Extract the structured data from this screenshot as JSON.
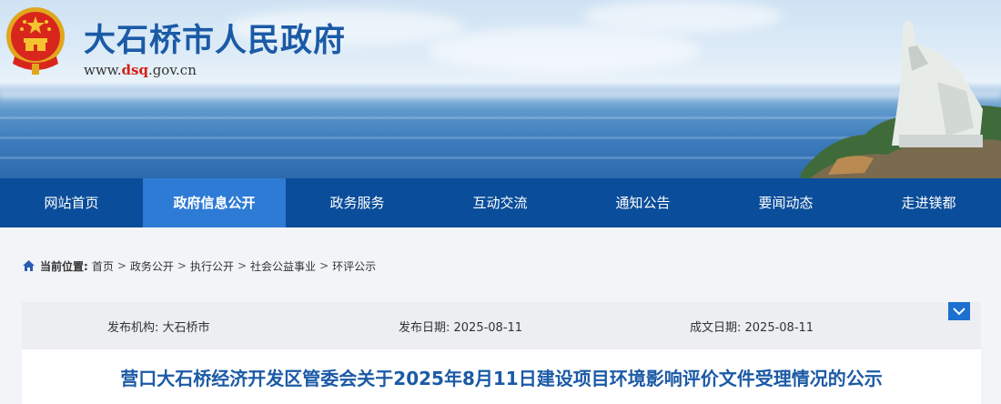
{
  "header": {
    "site_name": "大石桥市人民政府",
    "url_prefix": "www.",
    "url_highlight": "dsq",
    "url_suffix": ".gov.cn"
  },
  "nav": {
    "items": [
      {
        "label": "网站首页"
      },
      {
        "label": "政府信息公开",
        "active": true
      },
      {
        "label": "政务服务"
      },
      {
        "label": "互动交流"
      },
      {
        "label": "通知公告"
      },
      {
        "label": "要闻动态"
      },
      {
        "label": "走进镁都"
      }
    ],
    "color": "#0a4d9a",
    "active_color": "#2e7bd6"
  },
  "breadcrumb": {
    "label": "当前位置:",
    "items": [
      "首页",
      "政务公开",
      "执行公开",
      "社会公益事业",
      "环评公示"
    ],
    "separator": ">"
  },
  "meta": {
    "publisher": "发布机构: 大石桥市",
    "publish_date": "发布日期: 2025-08-11",
    "created_date": "成文日期: 2025-08-11"
  },
  "article": {
    "title": "营口大石桥经济开发区管委会关于2025年8月11日建设项目环境影响评价文件受理情况的公示"
  }
}
